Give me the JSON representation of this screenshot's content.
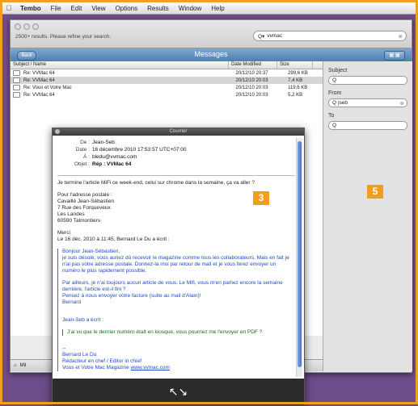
{
  "menubar": {
    "apple": "",
    "items": [
      "Tembo",
      "File",
      "Edit",
      "View",
      "Options",
      "Results",
      "Window",
      "Help"
    ]
  },
  "window": {
    "refine_text": "2500+ results. Please refine your search.",
    "search_value": "vvmac",
    "toolbar_title": "Messages",
    "back_label": "Back"
  },
  "list": {
    "columns": [
      "Subject / Name",
      "Date Modified",
      "Size"
    ],
    "rows": [
      {
        "subject": "Re: VVMac 64",
        "date": "20/12/10 20:37",
        "size": "299,6 KB"
      },
      {
        "subject": "Re: VVMac 64",
        "date": "20/12/10 20:03",
        "size": "7,4 KB"
      },
      {
        "subject": "Re: Vous et Votre Mac",
        "date": "20/12/10 20:03",
        "size": "119,6 KB"
      },
      {
        "subject": "Re: VVMac 64",
        "date": "20/12/10 20:03",
        "size": "5,2 KB"
      }
    ],
    "status_text": "Mil"
  },
  "sidebar": {
    "subject_label": "Subject",
    "from_label": "From",
    "from_value": "jseb",
    "to_label": "To"
  },
  "badges": {
    "mail": "3",
    "sidebar": "5"
  },
  "popup": {
    "title": "Courrier",
    "headers": [
      {
        "k": "De :",
        "v": "Jean-Seb"
      },
      {
        "k": "Date :",
        "v": "16 décembre 2010 17:53:57 UTC+07:00"
      },
      {
        "k": "À :",
        "v": "bledu@vvmac.com"
      },
      {
        "k": "Objet :",
        "v": "Rép : VVMac 64"
      }
    ],
    "body_intro": "Je termine l'article MiFi ce week-end, celui sur chrome dans la semaine, ça va aller ?",
    "address": [
      "Pour l'adresse postale :",
      "Cavaillé Jean-Sébastien",
      "7 Rue des Forqueveux",
      "Les Landes",
      "60590 Talmontiers"
    ],
    "merci": "Merci",
    "wrote": "Le 16 déc. 2010 à 11:45, Bernard Le Du a écrit :",
    "quote_lines": [
      "Bonjour Jean-Sébastien,",
      "je suis désolé, vous auriez dû recevoir le magazine comme tous les collaborateurs. Mais en fait je n'ai pas votre adresse postale. Donnez-la moi par retour de mail et je vous ferez envoyer un numéro le plus rapidement possible.",
      "Par ailleurs, je n'ai toujours aucun article de vous. Le Mifi, vous m'en parliez encore la semaine dernière, l'article est-il fini ?",
      "Pensez à nous envoyer votre facture (suite au mail d'Alain)!",
      "Bernard",
      "Jean-Seb a écrit :"
    ],
    "quote2": "J'ai vu que le dernier numéro était en kiosque, vous pourriez me l'envoyer en PDF ?",
    "sig": [
      "--",
      "Bernard Le Du",
      "Rédacteur en chef / Editor in chief",
      "Vous et Votre Mac Magazine"
    ],
    "sig_link": "www.vvmac.com",
    "footer_icon": "expand-arrows-icon"
  }
}
